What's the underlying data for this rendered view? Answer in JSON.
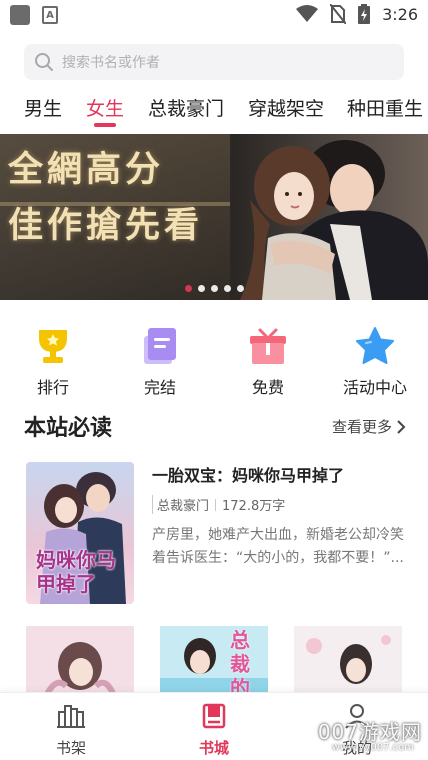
{
  "status_bar": {
    "time": "3:26"
  },
  "search": {
    "placeholder": "搜索书名或作者"
  },
  "tabs": [
    {
      "label": "男生",
      "active": false
    },
    {
      "label": "女生",
      "active": true
    },
    {
      "label": "总裁豪门",
      "active": false
    },
    {
      "label": "穿越架空",
      "active": false
    },
    {
      "label": "种田重生",
      "active": false
    }
  ],
  "banner": {
    "line1": "全網高分",
    "line2": "佳作搶先看",
    "dots": 5,
    "active_dot": 0
  },
  "entries": [
    {
      "label": "排行",
      "icon": "trophy-icon",
      "color": "#f5c400"
    },
    {
      "label": "完结",
      "icon": "book-icon",
      "color": "#a98cf2"
    },
    {
      "label": "免费",
      "icon": "gift-icon",
      "color": "#f4667a"
    },
    {
      "label": "活动中心",
      "icon": "star-icon",
      "color": "#3a9df3"
    }
  ],
  "section": {
    "title": "本站必读",
    "more": "查看更多"
  },
  "featured_book": {
    "cover_text": "妈咪你马甲掉了",
    "title": "一胎双宝：妈咪你马甲掉了",
    "category": "总裁豪门",
    "words": "172.8万字",
    "description": "产房里，她难产大出血，新婚老公却冷笑着告诉医生：“大的小的，我都不要！”..."
  },
  "cover_row": [
    {
      "text": ""
    },
    {
      "text": "总裁的"
    },
    {
      "text": ""
    }
  ],
  "bottom_nav": [
    {
      "label": "书架",
      "icon": "bookshelf-icon",
      "active": false
    },
    {
      "label": "书城",
      "icon": "bookstore-icon",
      "active": true
    },
    {
      "label": "我的",
      "icon": "profile-icon",
      "active": false
    }
  ],
  "watermark": {
    "main": "007游戏网",
    "sub": "www.yy007.com"
  },
  "colors": {
    "accent": "#e2375a",
    "search_bg": "#f3f3f5"
  }
}
